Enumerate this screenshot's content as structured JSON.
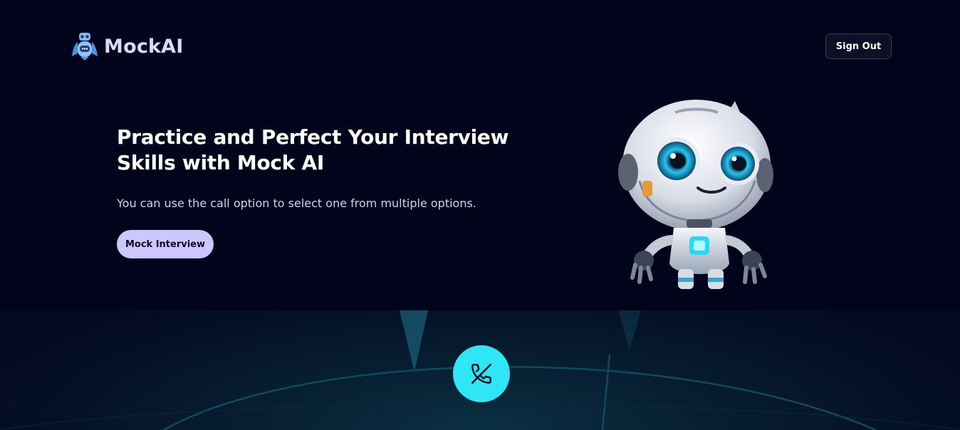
{
  "app": {
    "brand_name": "MockAI"
  },
  "navbar": {
    "sign_out_label": "Sign Out"
  },
  "hero": {
    "title": "Practice and Perfect Your Interview Skills with Mock AI",
    "subtitle": "You can use the call option to select one from multiple options.",
    "cta_label": "Mock Interview"
  },
  "call": {
    "icon": "phone-off-icon"
  },
  "colors": {
    "background": "#02041c",
    "brand_text": "#dcd8ff",
    "cta_background": "#cdc6ff",
    "call_button": "#2ee6f6"
  }
}
